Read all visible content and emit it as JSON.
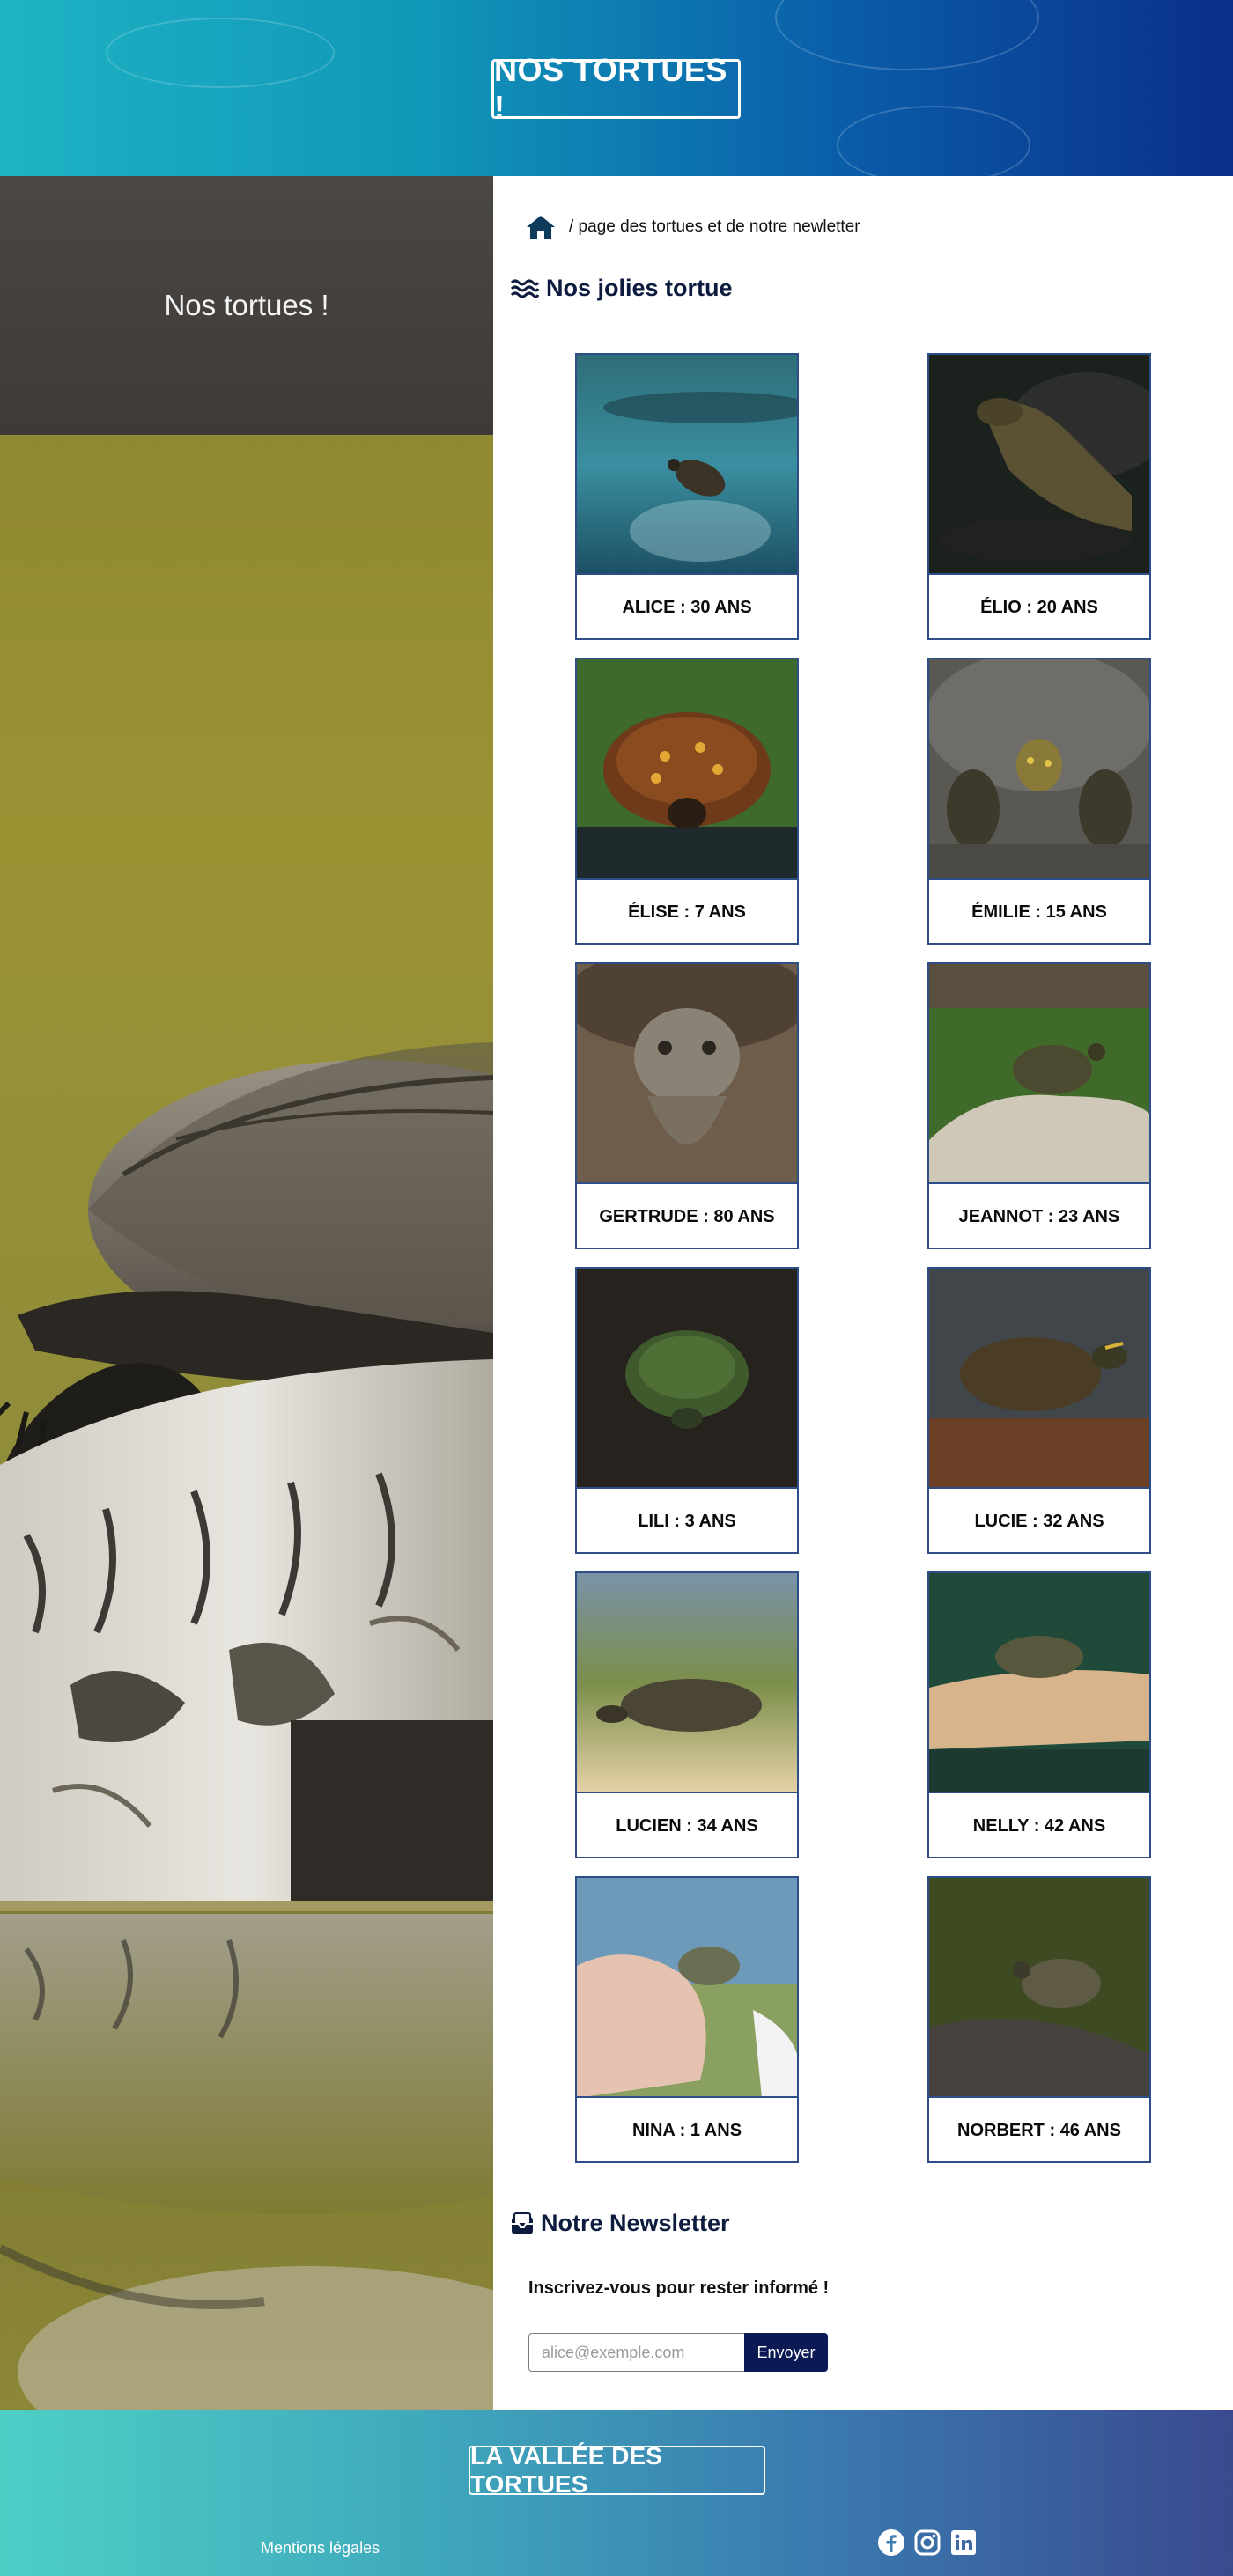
{
  "header": {
    "title": "NOS TORTUES !"
  },
  "left_banner": {
    "title": "Nos tortues !"
  },
  "breadcrumb": {
    "text": "/ page des tortues et de notre newletter"
  },
  "turtles_section": {
    "title": "Nos jolies tortue",
    "cards": [
      {
        "label": "ALICE : 30 ANS"
      },
      {
        "label": "ÉLIO : 20 ANS"
      },
      {
        "label": "ÉLISE : 7 ANS"
      },
      {
        "label": "ÉMILIE : 15 ANS"
      },
      {
        "label": "GERTRUDE : 80 ANS"
      },
      {
        "label": "JEANNOT : 23 ANS"
      },
      {
        "label": "LILI : 3 ANS"
      },
      {
        "label": "LUCIE : 32 ANS"
      },
      {
        "label": "LUCIEN : 34 ANS"
      },
      {
        "label": "NELLY : 42 ANS"
      },
      {
        "label": "NINA : 1 ANS"
      },
      {
        "label": "NORBERT : 46 ANS"
      }
    ]
  },
  "newsletter": {
    "title": "Notre Newsletter",
    "text": "Inscrivez-vous pour rester informé !",
    "placeholder": "alice@exemple.com",
    "button_label": "Envoyer"
  },
  "footer": {
    "title": "LA VALLÉE DES TORTUES",
    "legal_link": "Mentions légales",
    "social": [
      "facebook-icon",
      "instagram-icon",
      "linkedin-icon"
    ]
  },
  "colors": {
    "card_border": "#2d4e86",
    "button_bg": "#0b1a55",
    "title_color": "#0d1b3e"
  }
}
